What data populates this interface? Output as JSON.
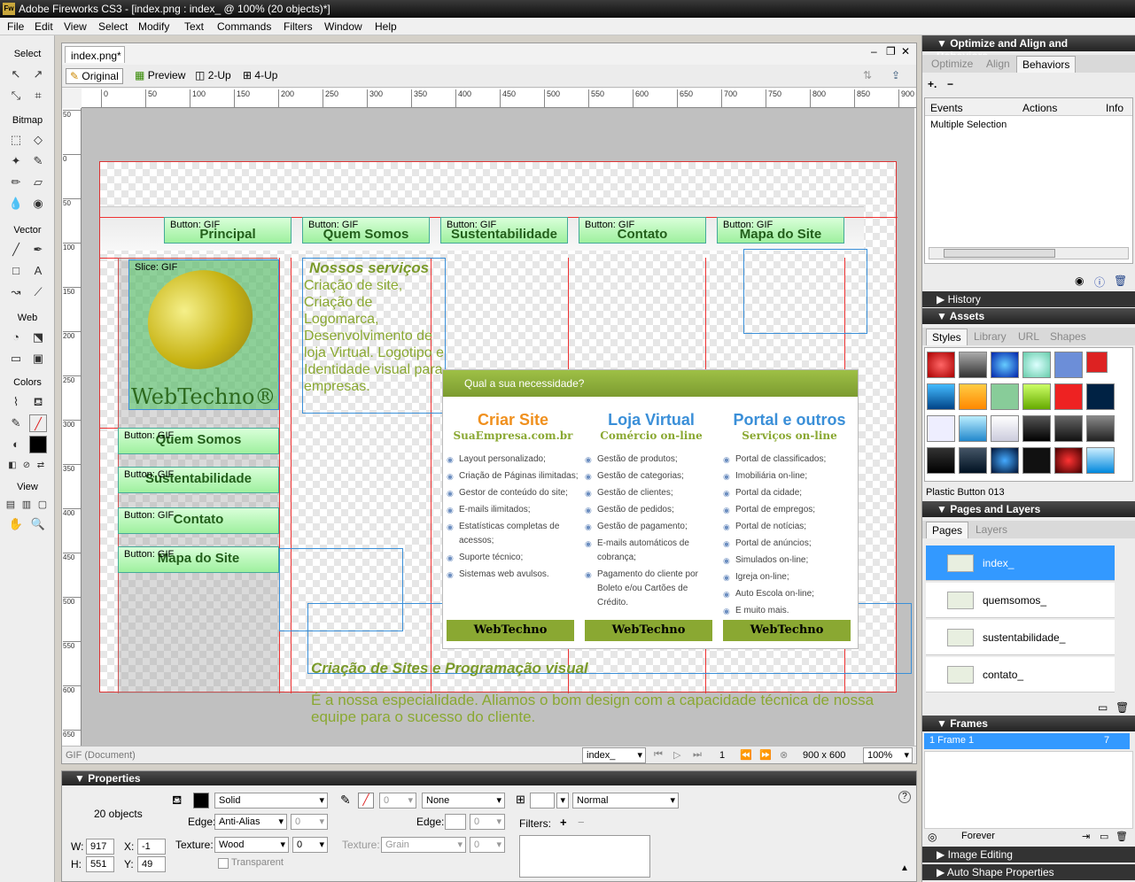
{
  "app": {
    "title": "Adobe Fireworks CS3 - [index.png : index_ @ 100% (20 objects)*]",
    "icon": "Fw"
  },
  "menu": [
    "File",
    "Edit",
    "View",
    "Select",
    "Modify",
    "Text",
    "Commands",
    "Filters",
    "Window",
    "Help"
  ],
  "tools": {
    "sections": [
      "Select",
      "Bitmap",
      "Vector",
      "Web",
      "Colors",
      "View"
    ]
  },
  "document": {
    "tab": "index.png*",
    "views": [
      "Original",
      "Preview",
      "2-Up",
      "4-Up"
    ],
    "ruler_h": [
      "0",
      "50",
      "100",
      "150",
      "200",
      "250",
      "300",
      "350",
      "400",
      "450",
      "500",
      "550",
      "600",
      "650",
      "700",
      "750",
      "800",
      "850",
      "900"
    ],
    "ruler_v": [
      "50",
      "0",
      "50",
      "100",
      "150",
      "200",
      "250",
      "300",
      "350",
      "400",
      "450",
      "500",
      "550",
      "600",
      "650"
    ]
  },
  "canvas": {
    "nav": [
      {
        "label": "Principal",
        "tag": "Button: GIF"
      },
      {
        "label": "Quem Somos",
        "tag": "Button: GIF"
      },
      {
        "label": "Sustentabilidade",
        "tag": "Button: GIF"
      },
      {
        "label": "Contato",
        "tag": "Button: GIF"
      },
      {
        "label": "Mapa do Site",
        "tag": "Button: GIF"
      }
    ],
    "slice_tag": "Slice: GIF",
    "logo": "WebTechno®",
    "side": [
      {
        "label": "Quem Somos",
        "tag": "Button: GIF"
      },
      {
        "label": "Sustentabilidade",
        "tag": "Button: GIF"
      },
      {
        "label": "Contato",
        "tag": "Button: GIF"
      },
      {
        "label": "Mapa do Site",
        "tag": "Button: GIF"
      }
    ],
    "services_title": "Nossos serviços",
    "services_text": "Criação de site, Criação de Logomarca, Desenvolvimento de loja Virtual. Logotipo e Identidade visual para empresas.",
    "panel_head": "Qual a sua necessidade?",
    "columns": [
      {
        "title": "Criar Site",
        "color": "#f0901e",
        "sub": "SuaEmpresa.com.br",
        "items": [
          "Layout personalizado;",
          "Criação de Páginas ilimitadas;",
          "Gestor de conteúdo do site;",
          "E-mails ilimitados;",
          "Estatísticas completas de acessos;",
          "Suporte técnico;",
          "Sistemas web avulsos."
        ],
        "foot": "WebTechno"
      },
      {
        "title": "Loja Virtual",
        "color": "#3a8fd8",
        "sub": "Comércio on-line",
        "items": [
          "Gestão de produtos;",
          "Gestão de categorias;",
          "Gestão de clientes;",
          "Gestão de pedidos;",
          "Gestão de pagamento;",
          "E-mails automáticos de cobrança;",
          "Pagamento do cliente por Boleto e/ou Cartões de Crédito."
        ],
        "foot": "WebTechno"
      },
      {
        "title": "Portal e outros",
        "color": "#3a8fd8",
        "sub": "Serviços on-line",
        "items": [
          "Portal de classificados;",
          "Imobiliária on-line;",
          "Portal da cidade;",
          "Portal de empregos;",
          "Portal de notícias;",
          "Portal de anúncios;",
          "Simulados on-line;",
          "Igreja on-line;",
          "Auto Escola on-line;",
          "E muito mais."
        ],
        "foot": "WebTechno"
      }
    ],
    "bottom_title": "Criação de Sites e Programação visual",
    "bottom_text": "É a nossa especialidade. Aliamos o bom design com a capacidade técnica de nossa equipe para o sucesso do cliente."
  },
  "status": {
    "left": "GIF (Document)",
    "page": "index_",
    "frame": "1",
    "size": "900 x 600",
    "zoom": "100%"
  },
  "properties": {
    "title": "Properties",
    "count": "20 objects",
    "w": "917",
    "x": "-1",
    "h": "551",
    "y": "49",
    "fill": "Solid",
    "edge": "Anti-Alias",
    "edge_val": "0",
    "texture": "Wood",
    "texture_val": "0",
    "transparent": "Transparent",
    "stroke_size": "0",
    "stroke": "None",
    "edge2_val": "0",
    "texture2": "Grain",
    "texture2_val": "0",
    "blend": "Normal",
    "labels": {
      "w": "W:",
      "x": "X:",
      "h": "H:",
      "y": "Y:",
      "edge": "Edge:",
      "texture": "Texture:",
      "edge2": "Edge:",
      "texture2": "Texture:",
      "filters": "Filters:"
    }
  },
  "right": {
    "optimize": {
      "title": "Optimize and Align and Behaviors",
      "tabs": [
        "Optimize",
        "Align",
        "Behaviors"
      ],
      "cols": [
        "Events",
        "Actions",
        "Info"
      ],
      "row": "Multiple Selection"
    },
    "history": "History",
    "assets": {
      "title": "Assets",
      "tabs": [
        "Styles",
        "Library",
        "URL",
        "Shapes"
      ],
      "selected": "Plastic Button 013"
    },
    "pages": {
      "title": "Pages and Layers",
      "tabs": [
        "Pages",
        "Layers"
      ],
      "items": [
        "index_",
        "quemsomos_",
        "sustentabilidade_",
        "contato_"
      ]
    },
    "frames": {
      "title": "Frames",
      "frame": "1  Frame 1",
      "delay": "7",
      "loop": "Forever"
    },
    "image_editing": "Image Editing",
    "auto_shape": "Auto Shape Properties"
  }
}
